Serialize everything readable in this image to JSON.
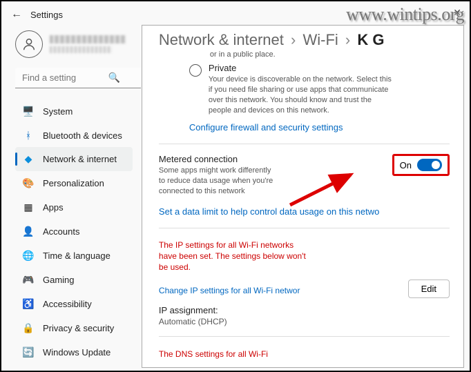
{
  "watermark": "www.wintips.org",
  "window_title": "Settings",
  "search": {
    "placeholder": "Find a setting"
  },
  "sidebar": {
    "items": [
      {
        "icon": "🖥️",
        "label": "System"
      },
      {
        "icon": "ᚼ",
        "label": "Bluetooth & devices",
        "iconColor": "#0067c0"
      },
      {
        "icon": "◆",
        "label": "Network & internet",
        "iconColor": "#0b8edc",
        "selected": true
      },
      {
        "icon": "🎨",
        "label": "Personalization"
      },
      {
        "icon": "▦",
        "label": "Apps"
      },
      {
        "icon": "👤",
        "label": "Accounts"
      },
      {
        "icon": "🌐",
        "label": "Time & language"
      },
      {
        "icon": "🎮",
        "label": "Gaming"
      },
      {
        "icon": "♿",
        "label": "Accessibility"
      },
      {
        "icon": "🔒",
        "label": "Privacy & security"
      },
      {
        "icon": "🔄",
        "label": "Windows Update"
      }
    ]
  },
  "breadcrumb": {
    "a": "Network & internet",
    "b": "Wi-Fi",
    "c": "K G"
  },
  "top_small": "or in a public place.",
  "private": {
    "label": "Private",
    "desc": "Your device is discoverable on the network. Select this if you need file sharing or use apps that communicate over this network. You should know and trust the people and devices on this network."
  },
  "firewall_link": "Configure firewall and security settings",
  "metered": {
    "title": "Metered connection",
    "desc": "Some apps might work differently to reduce data usage when you're connected to this network",
    "toggle_label": "On"
  },
  "data_limit_link": "Set a data limit to help control data usage on this netwo",
  "ip_warning": "The IP settings for all Wi-Fi networks have been set. The settings below won't be used.",
  "change_ip_link": "Change IP settings for all Wi-Fi networ",
  "edit_label": "Edit",
  "ip_assignment": {
    "label": "IP assignment:",
    "value": "Automatic (DHCP)"
  },
  "dns_warning": "The DNS settings for all Wi-Fi"
}
